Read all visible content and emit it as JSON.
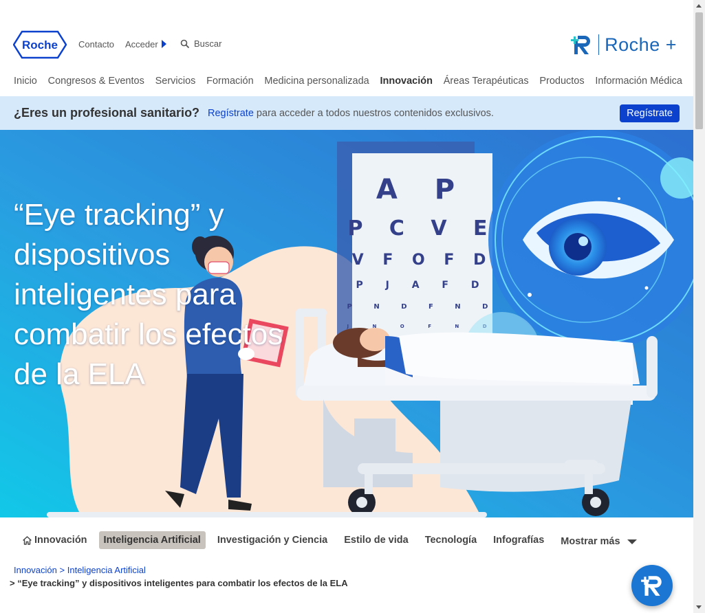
{
  "brand": {
    "logo_text": "Roche",
    "plus_text": "Roche +"
  },
  "util": {
    "contact": "Contacto",
    "login": "Acceder",
    "search": "Buscar"
  },
  "nav": [
    {
      "label": "Inicio"
    },
    {
      "label": "Congresos & Eventos"
    },
    {
      "label": "Servicios"
    },
    {
      "label": "Formación"
    },
    {
      "label": "Medicina personalizada"
    },
    {
      "label": "Innovación",
      "active": true
    },
    {
      "label": "Áreas Terapéuticas"
    },
    {
      "label": "Productos"
    },
    {
      "label": "Información Médica"
    }
  ],
  "banner": {
    "question": "¿Eres un profesional sanitario?",
    "link": "Regístrate",
    "text": " para acceder a todos nuestros contenidos exclusivos.",
    "button": "Regístrate"
  },
  "hero": {
    "title": "“Eye tracking” y dispositivos inteligentes para combatir los efectos de la ELA",
    "chart_rows": [
      "A P",
      "P C V E",
      "V F O F D",
      "P J A F D",
      "P N D F N D",
      "J N O F N D"
    ]
  },
  "tabs": [
    {
      "label": "Innovación",
      "icon": "home-icon"
    },
    {
      "label": "Inteligencia Artificial",
      "active": true
    },
    {
      "label": "Investigación y Ciencia"
    },
    {
      "label": "Estilo de vida"
    },
    {
      "label": "Tecnología"
    },
    {
      "label": "Infografías"
    },
    {
      "label": "Mostrar más",
      "more": true
    }
  ],
  "breadcrumb": {
    "items": [
      "Innovación",
      "Inteligencia Artificial"
    ],
    "separator": ">",
    "current": "> “Eye tracking” y dispositivos inteligentes para combatir los efectos de la ELA"
  },
  "colors": {
    "accent": "#0b41cd",
    "banner_bg": "#d6e9fb",
    "hero_blue": "#2f8fd8"
  }
}
